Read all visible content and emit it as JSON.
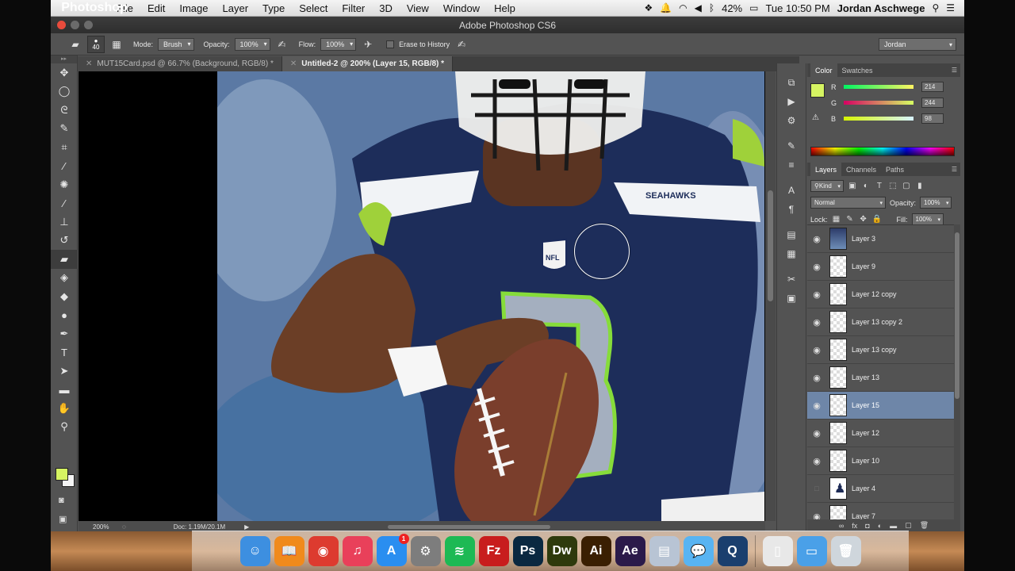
{
  "menubar": {
    "app_name": "Photoshop",
    "items": [
      "File",
      "Edit",
      "Image",
      "Layer",
      "Type",
      "Select",
      "Filter",
      "3D",
      "View",
      "Window",
      "Help"
    ],
    "battery": "42%",
    "clock": "Tue 10:50 PM",
    "user": "Jordan Aschwege"
  },
  "window": {
    "title": "Adobe Photoshop CS6"
  },
  "options": {
    "brush_size": "40",
    "mode_label": "Mode:",
    "mode_value": "Brush",
    "opacity_label": "Opacity:",
    "opacity_value": "100%",
    "flow_label": "Flow:",
    "flow_value": "100%",
    "erase_history_label": "Erase to History",
    "workspace": "Jordan"
  },
  "tabs": [
    {
      "label": "MUT15Card.psd @ 66.7% (Background, RGB/8) *",
      "active": false
    },
    {
      "label": "Untitled-2 @ 200% (Layer 15, RGB/8) *",
      "active": true
    }
  ],
  "tools": [
    {
      "name": "move-tool",
      "glyph": "✥"
    },
    {
      "name": "ellipse-marquee-tool",
      "glyph": "◯"
    },
    {
      "name": "lasso-tool",
      "glyph": "ᘓ"
    },
    {
      "name": "quick-selection-tool",
      "glyph": "✎"
    },
    {
      "name": "crop-tool",
      "glyph": "⌗"
    },
    {
      "name": "eyedropper-tool",
      "glyph": "⁄"
    },
    {
      "name": "spot-healing-tool",
      "glyph": "✺"
    },
    {
      "name": "brush-tool",
      "glyph": "∕"
    },
    {
      "name": "clone-stamp-tool",
      "glyph": "⊥"
    },
    {
      "name": "history-brush-tool",
      "glyph": "↺"
    },
    {
      "name": "eraser-tool",
      "glyph": "▰"
    },
    {
      "name": "paint-bucket-tool",
      "glyph": "◈"
    },
    {
      "name": "blur-tool",
      "glyph": "◆"
    },
    {
      "name": "dodge-tool",
      "glyph": "●"
    },
    {
      "name": "pen-tool",
      "glyph": "✒"
    },
    {
      "name": "type-tool",
      "glyph": "T"
    },
    {
      "name": "path-selection-tool",
      "glyph": "➤"
    },
    {
      "name": "rectangle-tool",
      "glyph": "▬"
    },
    {
      "name": "hand-tool",
      "glyph": "✋"
    },
    {
      "name": "zoom-tool",
      "glyph": "⚲"
    }
  ],
  "status": {
    "zoom": "200%",
    "doc": "Doc: 1.19M/20.1M"
  },
  "photo": {
    "jersey_text": "SEAHAWKS",
    "logo_text": "NFL"
  },
  "color_panel": {
    "tabs": [
      "Color",
      "Swatches"
    ],
    "r_label": "R",
    "r_value": "214",
    "g_label": "G",
    "g_value": "244",
    "b_label": "B",
    "b_value": "98",
    "swatch": "#d6f462"
  },
  "layers_panel": {
    "tabs": [
      "Layers",
      "Channels",
      "Paths"
    ],
    "kind": "Kind",
    "blend_mode": "Normal",
    "opacity_label": "Opacity:",
    "opacity_value": "100%",
    "lock_label": "Lock:",
    "fill_label": "Fill:",
    "fill_value": "100%",
    "layers": [
      {
        "name": "Layer 3",
        "visible": true,
        "thumb": "photo",
        "selected": false
      },
      {
        "name": "Layer 9",
        "visible": true,
        "thumb": "blank",
        "selected": false
      },
      {
        "name": "Layer 12 copy",
        "visible": true,
        "thumb": "blank",
        "selected": false
      },
      {
        "name": "Layer 13 copy 2",
        "visible": true,
        "thumb": "blank",
        "selected": false
      },
      {
        "name": "Layer 13 copy",
        "visible": true,
        "thumb": "blank",
        "selected": false
      },
      {
        "name": "Layer 13",
        "visible": true,
        "thumb": "blank",
        "selected": false
      },
      {
        "name": "Layer 15",
        "visible": true,
        "thumb": "blank",
        "selected": true
      },
      {
        "name": "Layer 12",
        "visible": true,
        "thumb": "blank",
        "selected": false
      },
      {
        "name": "Layer 10",
        "visible": true,
        "thumb": "blank",
        "selected": false
      },
      {
        "name": "Layer 4",
        "visible": false,
        "thumb": "figure",
        "selected": false
      },
      {
        "name": "Layer 7",
        "visible": true,
        "thumb": "blank",
        "selected": false
      }
    ]
  },
  "dock": [
    {
      "name": "finder",
      "label": "☺",
      "color": "#3d8fe0"
    },
    {
      "name": "ibooks",
      "label": "📖",
      "color": "#f08a1c"
    },
    {
      "name": "chrome",
      "label": "◉",
      "color": "#dd3b2f"
    },
    {
      "name": "itunes",
      "label": "♫",
      "color": "#e9405a"
    },
    {
      "name": "app-store",
      "label": "A",
      "color": "#2a8ef0",
      "badge": "1"
    },
    {
      "name": "system-preferences",
      "label": "⚙",
      "color": "#7d7d7d"
    },
    {
      "name": "spotify",
      "label": "≋",
      "color": "#1db954"
    },
    {
      "name": "filezilla",
      "label": "Fz",
      "color": "#c81d1d"
    },
    {
      "name": "photoshop",
      "label": "Ps",
      "color": "#0a2840"
    },
    {
      "name": "dreamweaver",
      "label": "Dw",
      "color": "#2e3a0c"
    },
    {
      "name": "illustrator",
      "label": "Ai",
      "color": "#3a1f02"
    },
    {
      "name": "after-effects",
      "label": "Ae",
      "color": "#2b1a4a"
    },
    {
      "name": "preview",
      "label": "▤",
      "color": "#b8c4d4"
    },
    {
      "name": "messages",
      "label": "💬",
      "color": "#58b4f2"
    },
    {
      "name": "quicktime",
      "label": "Q",
      "color": "#1a3f6e"
    },
    {
      "name": "documents-folder",
      "label": "▯",
      "color": "#e8e8e8"
    },
    {
      "name": "downloads-folder",
      "label": "▭",
      "color": "#4aa0e8"
    },
    {
      "name": "trash",
      "label": "🗑",
      "color": "#cfd6dc"
    }
  ]
}
